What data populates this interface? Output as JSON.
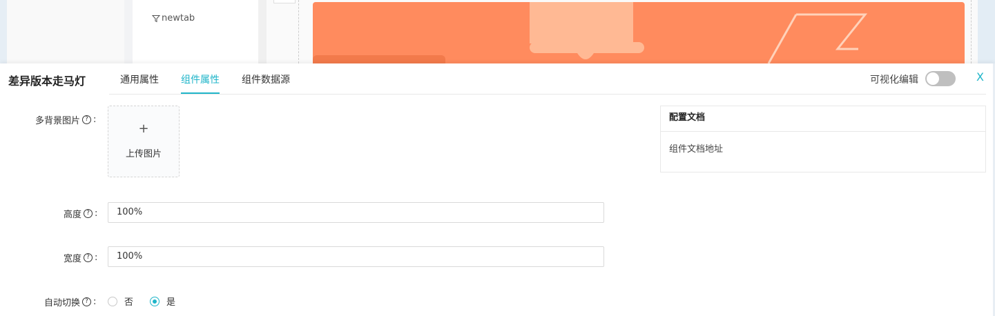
{
  "background": {
    "tree_item": "newtab",
    "banner_color": "#ff8b5e"
  },
  "panel": {
    "title": "差异版本走马灯",
    "tabs": [
      "通用属性",
      "组件属性",
      "组件数据源"
    ],
    "active_tab": "组件属性",
    "visual_edit_label": "可视化编辑",
    "visual_edit_on": false,
    "close_label": "X",
    "accent_color": "#1fb5c9"
  },
  "form": {
    "bg_images_label": "多背景图片",
    "upload_plus": "+",
    "upload_text": "上传图片",
    "height_label": "高度",
    "height_value": "100%",
    "width_label": "宽度",
    "width_value": "100%",
    "autoplay_label": "自动切换",
    "autoplay_options": [
      "否",
      "是"
    ],
    "autoplay_selected": "是",
    "colon": ":"
  },
  "doc": {
    "title": "配置文档",
    "link": "组件文档地址"
  }
}
